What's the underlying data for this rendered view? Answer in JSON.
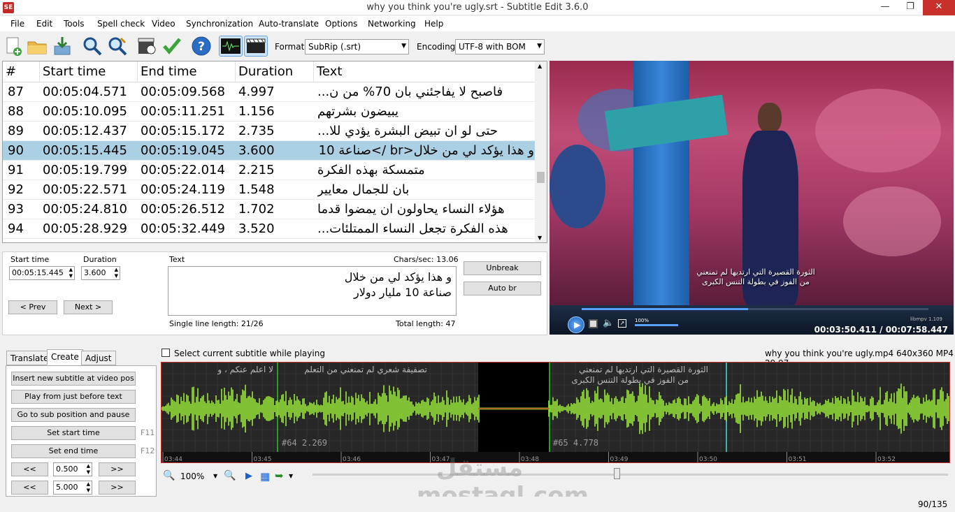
{
  "window": {
    "title": "why you think you're ugly.srt - Subtitle Edit 3.6.0",
    "icon_text": "SE"
  },
  "menu": [
    "File",
    "Edit",
    "Tools",
    "Spell check",
    "Video",
    "Synchronization",
    "Auto-translate",
    "Options",
    "Networking",
    "Help"
  ],
  "toolbar": {
    "format_label": "Format",
    "format_value": "SubRip (.srt)",
    "encoding_label": "Encoding",
    "encoding_value": "UTF-8 with BOM"
  },
  "grid": {
    "headers": [
      "#",
      "Start time",
      "End time",
      "Duration",
      "Text"
    ],
    "rows": [
      {
        "num": "87",
        "start": "00:05:04.571",
        "end": "00:05:09.568",
        "dur": "4.997",
        "text": "فاصبح لا يفاجئني بان 70% من ن...",
        "selected": false
      },
      {
        "num": "88",
        "start": "00:05:10.095",
        "end": "00:05:11.251",
        "dur": "1.156",
        "text": "يبيضون بشرتهم",
        "selected": false
      },
      {
        "num": "89",
        "start": "00:05:12.437",
        "end": "00:05:15.172",
        "dur": "2.735",
        "text": "حتى لو ان تبيض البشرة يؤدي للا...",
        "selected": false
      },
      {
        "num": "90",
        "start": "00:05:15.445",
        "end": "00:05:19.045",
        "dur": "3.600",
        "text": "و هذا يؤكد لي من خلال<br />صناعة 10 مليار دولار",
        "selected": true
      },
      {
        "num": "91",
        "start": "00:05:19.799",
        "end": "00:05:22.014",
        "dur": "2.215",
        "text": "متمسكة بهذه الفكرة",
        "selected": false
      },
      {
        "num": "92",
        "start": "00:05:22.571",
        "end": "00:05:24.119",
        "dur": "1.548",
        "text": "بان للجمال معايير",
        "selected": false
      },
      {
        "num": "93",
        "start": "00:05:24.810",
        "end": "00:05:26.512",
        "dur": "1.702",
        "text": "هؤلاء النساء يحاولون ان يمضوا قدما",
        "selected": false
      },
      {
        "num": "94",
        "start": "00:05:28.929",
        "end": "00:05:32.449",
        "dur": "3.520",
        "text": "هذه الفكرة تجعل النساء الممتلئات...",
        "selected": false
      }
    ]
  },
  "video": {
    "subtitle_line1": "الثورة القصيرة التي ارتديها لم تمنعني",
    "subtitle_line2": "من الفوز في بطولة التنس الكبرى",
    "volume": "100%",
    "engine": "libmpv 1.109",
    "time": "00:03:50.411 / 00:07:58.447",
    "position": 0.48,
    "volume_level": 1.0
  },
  "edit": {
    "start_label": "Start time",
    "start_value": "00:05:15.445",
    "duration_label": "Duration",
    "duration_value": "3.600",
    "text_label": "Text",
    "chars_sec": "Chars/sec: 13.06",
    "line1": "و هذا يؤكد لي من خلال",
    "line2": "صناعة 10 مليار دولار",
    "single_line": "Single line length: 21/26",
    "total_length": "Total length: 47",
    "prev": "< Prev",
    "next": "Next >",
    "unbreak": "Unbreak",
    "autobr": "Auto br"
  },
  "bottom": {
    "tabs": [
      "Translate",
      "Create",
      "Adjust"
    ],
    "buttons": [
      "Insert new subtitle at video pos",
      "Play from just before text",
      "Go to sub position and pause",
      "Set start time",
      "Set end time"
    ],
    "f11": "F11",
    "f12": "F12",
    "back": "<<",
    "fwd": ">>",
    "step1": "0.500",
    "step2": "5.000",
    "select_current": "Select current subtitle while playing",
    "video_info": "why you think you're ugly.mp4 640x360 MP4 29.97",
    "zoom": "100%"
  },
  "waveform": {
    "top_texts": [
      "لا اعلم عنكم ، و",
      "تصفيفة شعري لم تمنعني من التعلم",
      "الثورة القصيرة التي ارتديها لم تمنعني",
      "من الفوز في بطولة التنس الكبرى"
    ],
    "seg64": "#64  2.269",
    "seg65": "#65  4.778",
    "ticks": [
      "03:44",
      "03:45",
      "03:46",
      "03:47",
      "03:48",
      "03:49",
      "03:50",
      "03:51",
      "03:52"
    ]
  },
  "status": {
    "position": "90/135"
  },
  "watermark": "مستقل mostaql.com"
}
